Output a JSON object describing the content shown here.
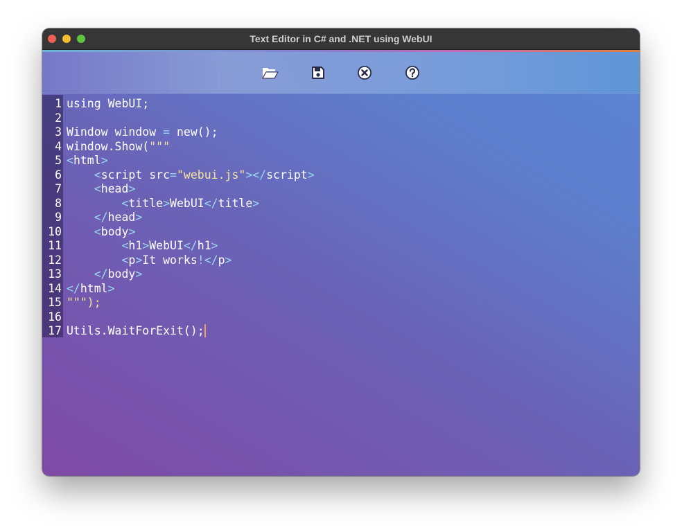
{
  "window": {
    "title": "Text Editor in C# and .NET using WebUI"
  },
  "toolbar": {
    "buttons": [
      {
        "name": "open",
        "icon": "folder-open-icon"
      },
      {
        "name": "save",
        "icon": "floppy-disk-icon"
      },
      {
        "name": "close",
        "icon": "close-circle-icon"
      },
      {
        "name": "help",
        "icon": "question-circle-icon"
      }
    ]
  },
  "editor": {
    "lines": [
      {
        "n": "1",
        "tokens": [
          {
            "t": "using WebUI;",
            "k": "plain"
          }
        ]
      },
      {
        "n": "2",
        "tokens": []
      },
      {
        "n": "3",
        "tokens": [
          {
            "t": "Window window ",
            "k": "plain"
          },
          {
            "t": "=",
            "k": "eq"
          },
          {
            "t": " new();",
            "k": "plain"
          }
        ]
      },
      {
        "n": "4",
        "tokens": [
          {
            "t": "window.Show(",
            "k": "plain"
          },
          {
            "t": "\"\"\"",
            "k": "str"
          }
        ]
      },
      {
        "n": "5",
        "tokens": [
          {
            "t": "<",
            "k": "tag"
          },
          {
            "t": "html",
            "k": "plain"
          },
          {
            "t": ">",
            "k": "tag"
          }
        ]
      },
      {
        "n": "6",
        "tokens": [
          {
            "t": "    ",
            "k": "plain"
          },
          {
            "t": "<",
            "k": "tag"
          },
          {
            "t": "script src",
            "k": "plain"
          },
          {
            "t": "=",
            "k": "eq"
          },
          {
            "t": "\"webui.js\"",
            "k": "str"
          },
          {
            "t": "></",
            "k": "tag"
          },
          {
            "t": "script",
            "k": "plain"
          },
          {
            "t": ">",
            "k": "tag"
          }
        ]
      },
      {
        "n": "7",
        "tokens": [
          {
            "t": "    ",
            "k": "plain"
          },
          {
            "t": "<",
            "k": "tag"
          },
          {
            "t": "head",
            "k": "plain"
          },
          {
            "t": ">",
            "k": "tag"
          }
        ]
      },
      {
        "n": "8",
        "tokens": [
          {
            "t": "        ",
            "k": "plain"
          },
          {
            "t": "<",
            "k": "tag"
          },
          {
            "t": "title",
            "k": "plain"
          },
          {
            "t": ">",
            "k": "tag"
          },
          {
            "t": "WebUI",
            "k": "plain"
          },
          {
            "t": "</",
            "k": "tag"
          },
          {
            "t": "title",
            "k": "plain"
          },
          {
            "t": ">",
            "k": "tag"
          }
        ]
      },
      {
        "n": "9",
        "tokens": [
          {
            "t": "    ",
            "k": "plain"
          },
          {
            "t": "</",
            "k": "tag"
          },
          {
            "t": "head",
            "k": "plain"
          },
          {
            "t": ">",
            "k": "tag"
          }
        ]
      },
      {
        "n": "10",
        "tokens": [
          {
            "t": "    ",
            "k": "plain"
          },
          {
            "t": "<",
            "k": "tag"
          },
          {
            "t": "body",
            "k": "plain"
          },
          {
            "t": ">",
            "k": "tag"
          }
        ]
      },
      {
        "n": "11",
        "tokens": [
          {
            "t": "        ",
            "k": "plain"
          },
          {
            "t": "<",
            "k": "tag"
          },
          {
            "t": "h1",
            "k": "plain"
          },
          {
            "t": ">",
            "k": "tag"
          },
          {
            "t": "WebUI",
            "k": "plain"
          },
          {
            "t": "</",
            "k": "tag"
          },
          {
            "t": "h1",
            "k": "plain"
          },
          {
            "t": ">",
            "k": "tag"
          }
        ]
      },
      {
        "n": "12",
        "tokens": [
          {
            "t": "        ",
            "k": "plain"
          },
          {
            "t": "<",
            "k": "tag"
          },
          {
            "t": "p",
            "k": "plain"
          },
          {
            "t": ">",
            "k": "tag"
          },
          {
            "t": "It works",
            "k": "plain"
          },
          {
            "t": "!",
            "k": "tag"
          },
          {
            "t": "</",
            "k": "tag"
          },
          {
            "t": "p",
            "k": "plain"
          },
          {
            "t": ">",
            "k": "tag"
          }
        ]
      },
      {
        "n": "13",
        "tokens": [
          {
            "t": "    ",
            "k": "plain"
          },
          {
            "t": "</",
            "k": "tag"
          },
          {
            "t": "body",
            "k": "plain"
          },
          {
            "t": ">",
            "k": "tag"
          }
        ]
      },
      {
        "n": "14",
        "tokens": [
          {
            "t": "</",
            "k": "tag"
          },
          {
            "t": "html",
            "k": "plain"
          },
          {
            "t": ">",
            "k": "tag"
          }
        ]
      },
      {
        "n": "15",
        "tokens": [
          {
            "t": "\"\"\");",
            "k": "str"
          }
        ]
      },
      {
        "n": "16",
        "tokens": []
      },
      {
        "n": "17",
        "tokens": [
          {
            "t": "Utils.WaitForExit();",
            "k": "plain"
          }
        ],
        "caret": true
      }
    ]
  },
  "colors": {
    "tag": "#9ad8f0",
    "string": "#f6e39a",
    "caret": "#f0a060"
  }
}
